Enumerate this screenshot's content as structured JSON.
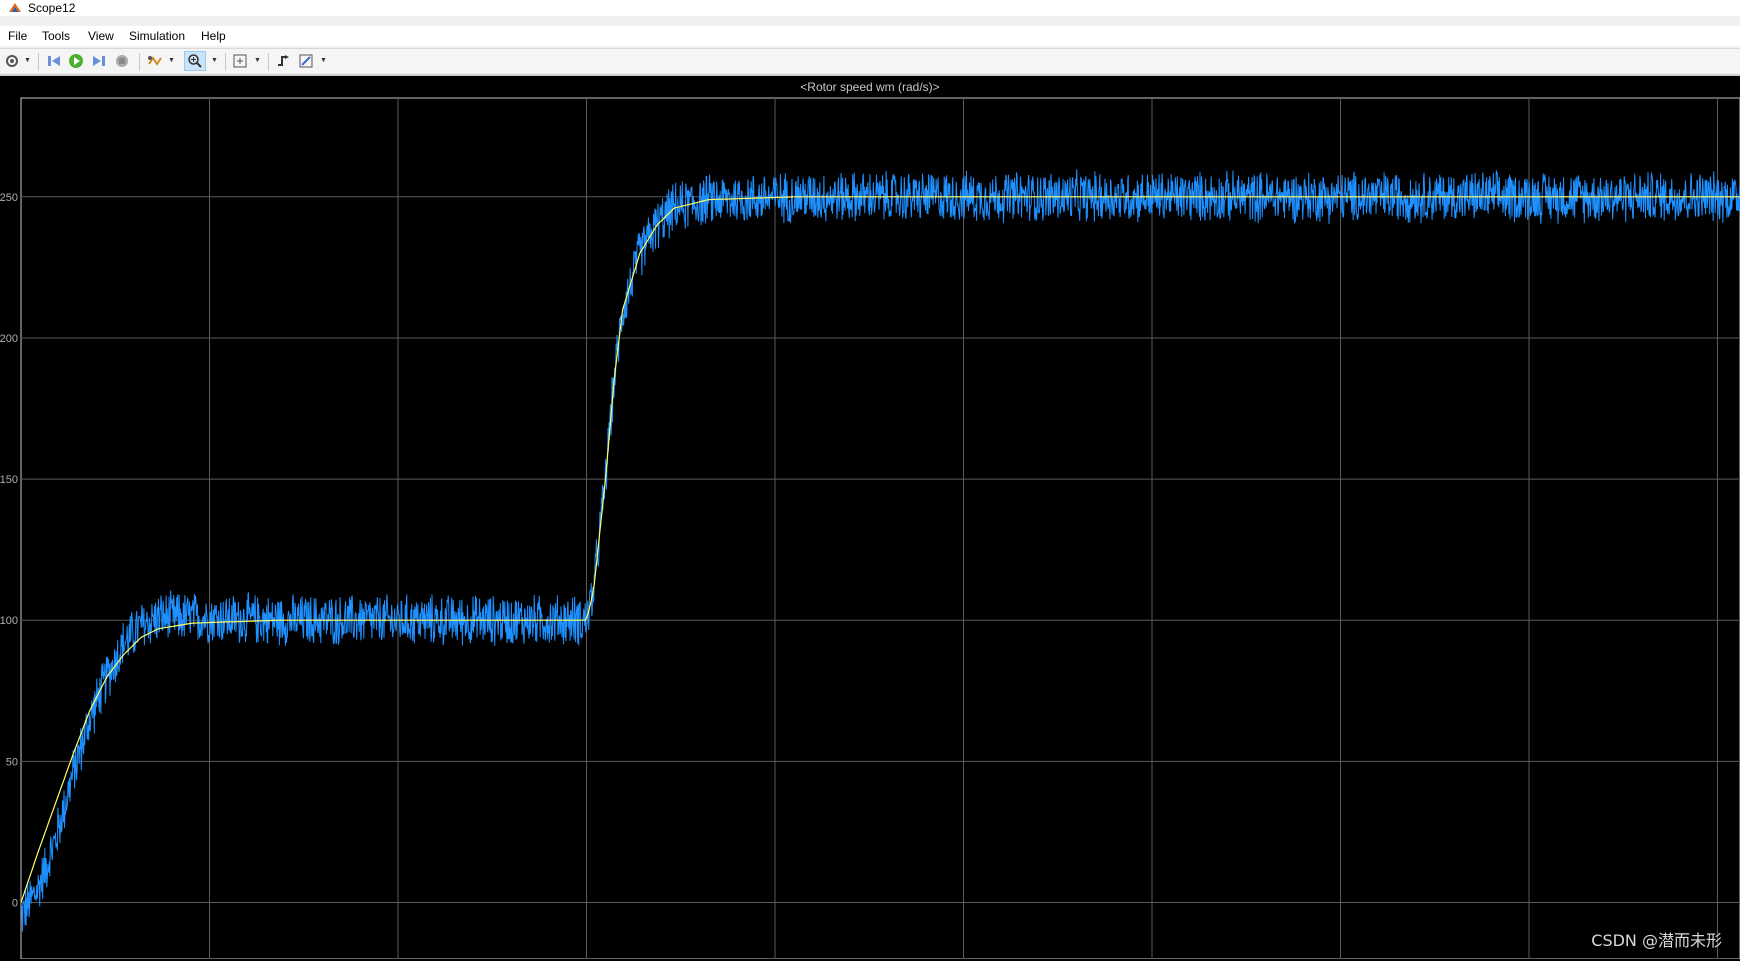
{
  "window": {
    "title": "Scope12"
  },
  "menu": {
    "items": [
      "File",
      "Tools",
      "View",
      "Simulation",
      "Help"
    ]
  },
  "toolbar": {
    "buttons": [
      {
        "name": "configuration-properties-icon"
      },
      {
        "name": "step-back-icon"
      },
      {
        "name": "run-icon"
      },
      {
        "name": "step-forward-icon"
      },
      {
        "name": "stop-icon"
      },
      {
        "name": "signal-highlight-icon"
      },
      {
        "name": "zoom-in-icon",
        "selected": true
      },
      {
        "name": "autoscale-icon"
      },
      {
        "name": "triggers-icon"
      },
      {
        "name": "cursor-measurements-icon"
      }
    ]
  },
  "chart_data": {
    "type": "line",
    "title": "<Rotor speed wm (rad/s)>",
    "ylim": [
      -20,
      285
    ],
    "yticks": [
      0,
      50,
      100,
      150,
      200,
      250
    ],
    "ytick_labels": [
      "0",
      "50",
      "100",
      "150",
      "200",
      "250"
    ],
    "xlim": [
      0,
      1
    ],
    "grid": true,
    "background": "#000000",
    "series": [
      {
        "color": "#ffff66",
        "points": [
          [
            0,
            0
          ],
          [
            0.01,
            18
          ],
          [
            0.02,
            35
          ],
          [
            0.03,
            52
          ],
          [
            0.04,
            68
          ],
          [
            0.05,
            80
          ],
          [
            0.06,
            88
          ],
          [
            0.07,
            94
          ],
          [
            0.08,
            97
          ],
          [
            0.1,
            99
          ],
          [
            0.15,
            100
          ],
          [
            0.329,
            100
          ],
          [
            0.333,
            110
          ],
          [
            0.34,
            150
          ],
          [
            0.345,
            185
          ],
          [
            0.35,
            210
          ],
          [
            0.36,
            230
          ],
          [
            0.37,
            240
          ],
          [
            0.38,
            246
          ],
          [
            0.4,
            249
          ],
          [
            0.45,
            250
          ],
          [
            1,
            250
          ]
        ]
      },
      {
        "color": "#1e90ff",
        "noise_amplitude": 10,
        "points": [
          [
            0,
            -5
          ],
          [
            0.01,
            5
          ],
          [
            0.02,
            22
          ],
          [
            0.03,
            45
          ],
          [
            0.04,
            65
          ],
          [
            0.05,
            80
          ],
          [
            0.06,
            92
          ],
          [
            0.07,
            98
          ],
          [
            0.08,
            101
          ],
          [
            0.1,
            101
          ],
          [
            0.15,
            100
          ],
          [
            0.329,
            100
          ],
          [
            0.333,
            110
          ],
          [
            0.34,
            150
          ],
          [
            0.345,
            185
          ],
          [
            0.35,
            210
          ],
          [
            0.36,
            230
          ],
          [
            0.37,
            240
          ],
          [
            0.38,
            246
          ],
          [
            0.4,
            249
          ],
          [
            0.45,
            250
          ],
          [
            1,
            250
          ]
        ]
      }
    ]
  },
  "watermark": "CSDN @潜而未形",
  "colors": {
    "grid": "#5a5a5a",
    "axis": "#c8c8c8",
    "tick_text": "#b0b0b0"
  }
}
